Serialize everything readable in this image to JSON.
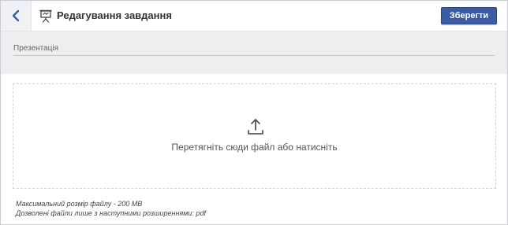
{
  "header": {
    "back_icon": "chevron-left-icon",
    "title_icon": "presentation-board-icon",
    "title": "Редагування завдання",
    "save_label": "Зберегти"
  },
  "form": {
    "field_label": "Презентація"
  },
  "upload": {
    "icon": "upload-icon",
    "text": "Перетягніть сюди файл або натисніть",
    "max_size_hint": "Максимальний розмір файлу - 200 MB",
    "allowed_hint": "Дозволені файли лише з наступними розширеннями: pdf"
  },
  "colors": {
    "accent": "#3b5ba5",
    "header_back_bg": "#f0f1f4",
    "form_band_bg": "#eeeeee"
  }
}
